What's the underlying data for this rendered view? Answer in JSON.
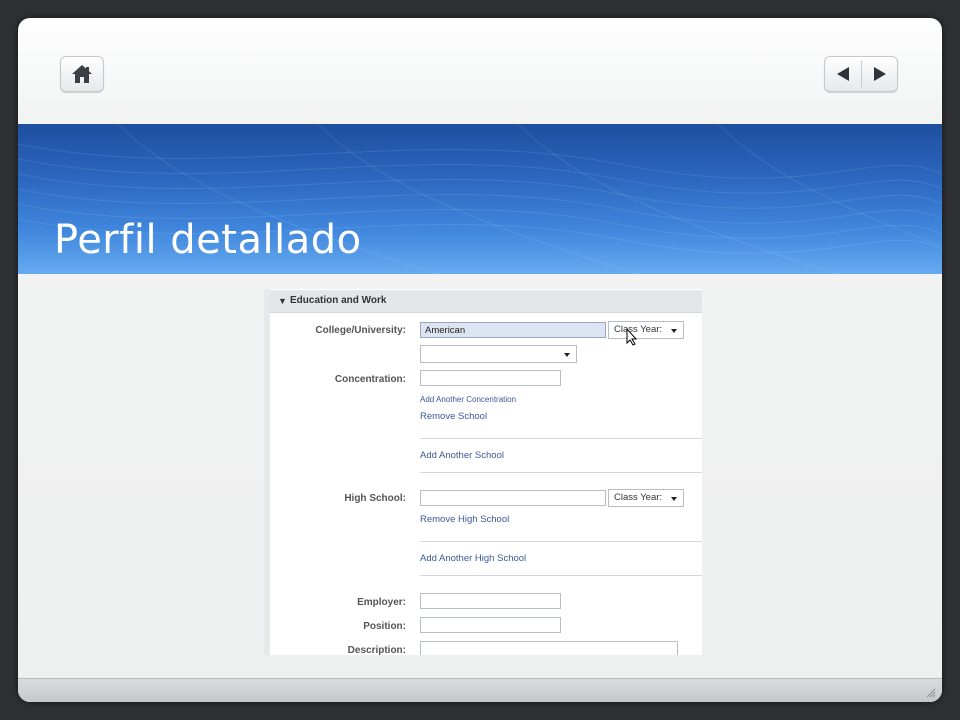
{
  "slide": {
    "title": "Perfil detallado",
    "nav": {
      "home": "home-icon",
      "prev": "prev-arrow-icon",
      "next": "next-arrow-icon"
    }
  },
  "form": {
    "section_header": "Education and Work",
    "college_label": "College/University:",
    "college_value": "American",
    "class_year_label": "Class Year:",
    "concentration_label": "Concentration:",
    "add_concentration": "Add Another Concentration",
    "remove_school": "Remove School",
    "add_school": "Add Another School",
    "high_school_label": "High School:",
    "hs_class_year_label": "Class Year:",
    "remove_high_school": "Remove High School",
    "add_high_school": "Add Another High School",
    "employer_label": "Employer:",
    "position_label": "Position:",
    "description_label": "Description:"
  },
  "colors": {
    "banner_dark": "#1e4f9e",
    "banner_light": "#66aaf0",
    "link": "#3b5998"
  }
}
